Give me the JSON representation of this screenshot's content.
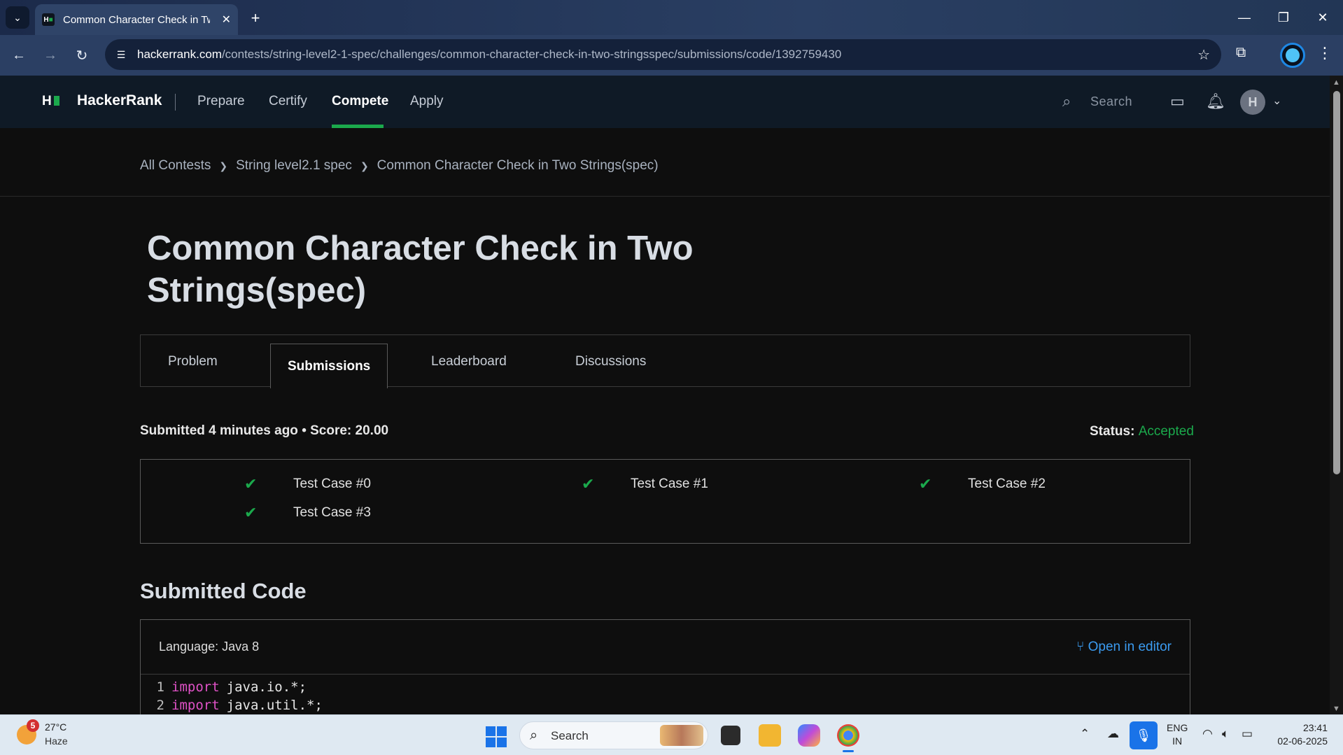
{
  "browser": {
    "tab_title": "Common Character Check in Tw",
    "url_host": "hackerrank.com",
    "url_path": "/contests/string-level2-1-spec/challenges/common-character-check-in-two-stringsspec/submissions/code/1392759430"
  },
  "header": {
    "brand": "HackerRank",
    "nav": [
      "Prepare",
      "Certify",
      "Compete",
      "Apply"
    ],
    "active_nav": "Compete",
    "search_placeholder": "Search",
    "avatar_initial": "H"
  },
  "breadcrumb": {
    "items": [
      "All Contests",
      "String level2.1 spec",
      "Common Character Check in Two Strings(spec)"
    ]
  },
  "page": {
    "title_line1": "Common Character Check in Two",
    "title_line2": "Strings(spec)"
  },
  "content_tabs": [
    "Problem",
    "Submissions",
    "Leaderboard",
    "Discussions"
  ],
  "active_tab": "Submissions",
  "submission": {
    "summary": "Submitted 4 minutes ago • Score: 20.00",
    "status_label": "Status:",
    "status_value": "Accepted",
    "status_color": "#1ba94c",
    "test_cases": [
      "Test Case #0",
      "Test Case #1",
      "Test Case #2",
      "Test Case #3"
    ]
  },
  "code_section": {
    "title": "Submitted Code",
    "language": "Language: Java 8",
    "open_editor": "Open in editor",
    "lines": [
      {
        "num": "1",
        "keyword": "import",
        "rest": "java.io.*;"
      },
      {
        "num": "2",
        "keyword": "import",
        "rest": "java.util.*;"
      }
    ]
  },
  "taskbar": {
    "weather_badge": "5",
    "temperature": "27°C",
    "condition": "Haze",
    "search_label": "Search",
    "lang_line1": "ENG",
    "lang_line2": "IN",
    "time": "23:41",
    "date": "02-06-2025"
  },
  "colors": {
    "accent_green": "#1ba94c",
    "link_blue": "#3b9bf0",
    "keyword_pink": "#e052c7"
  }
}
